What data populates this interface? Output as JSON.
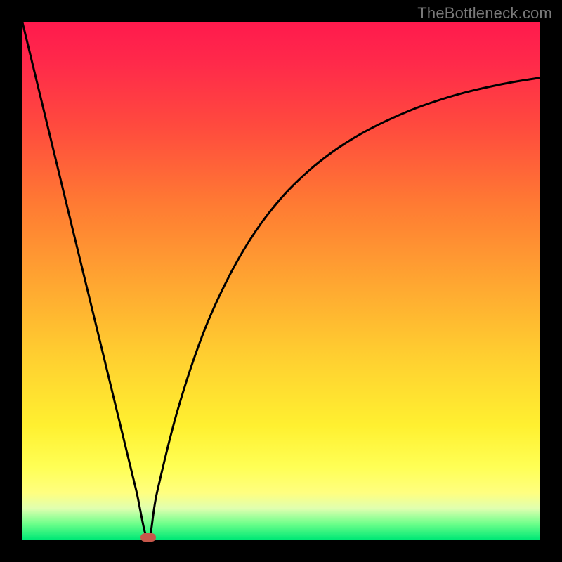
{
  "watermark": "TheBottleneck.com",
  "colors": {
    "background": "#000000",
    "gradient_top": "#ff1a4d",
    "gradient_bottom": "#00e876",
    "curve": "#000000",
    "marker": "#c7574b"
  },
  "chart_data": {
    "type": "line",
    "title": "",
    "xlabel": "",
    "ylabel": "",
    "xlim": [
      0,
      100
    ],
    "ylim": [
      0,
      100
    ],
    "grid": false,
    "legend": false,
    "description": "Bottleneck curve: V-shaped profile reaching 0 near x≈24, rising asymptotically toward ~90 on the right",
    "minimum_x": 24.3,
    "minimum_y": 0,
    "series": [
      {
        "name": "bottleneck",
        "x": [
          0,
          5,
          10,
          15,
          20,
          22,
          24.3,
          26,
          30,
          35,
          40,
          45,
          50,
          55,
          60,
          65,
          70,
          75,
          80,
          85,
          90,
          95,
          100
        ],
        "values": [
          100,
          79.4,
          58.8,
          38.3,
          17.7,
          9.5,
          0.0,
          9.0,
          25.0,
          40.0,
          51.0,
          59.5,
          66.0,
          71.0,
          75.0,
          78.2,
          80.8,
          83.0,
          84.8,
          86.3,
          87.5,
          88.5,
          89.3
        ]
      }
    ],
    "marker": {
      "x": 24.3,
      "y": 0
    }
  }
}
